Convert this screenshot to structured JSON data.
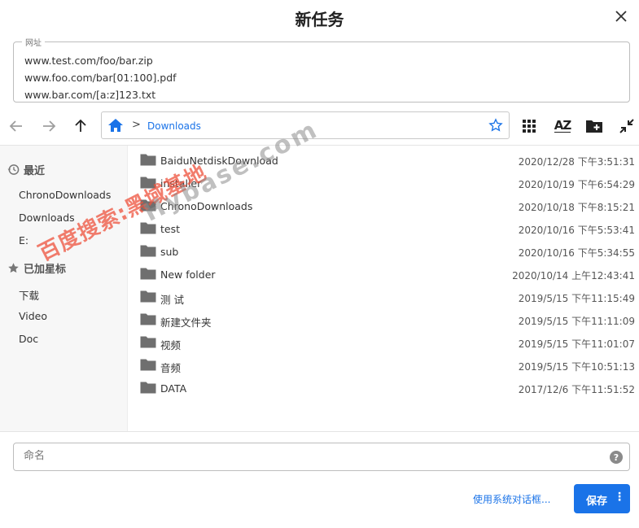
{
  "dialog": {
    "title": "新任务"
  },
  "url_field": {
    "legend": "网址",
    "lines": [
      "www.test.com/foo/bar.zip",
      "www.foo.com/bar[01:100].pdf",
      "www.bar.com/[a:z]123.txt"
    ]
  },
  "toolbar": {
    "icons": [
      "back-arrow-icon",
      "forward-arrow-icon",
      "up-arrow-icon",
      "home-icon",
      "chevron-right-icon",
      "star-outline-icon",
      "grid-view-icon",
      "sort-az-icon",
      "new-folder-icon",
      "collapse-icon"
    ],
    "breadcrumb_sep": ">",
    "breadcrumb": "Downloads",
    "sort_label": "AZ"
  },
  "sidebar": {
    "recent_label": "最近",
    "recent_items": [
      "ChronoDownloads",
      "Downloads",
      "E:"
    ],
    "starred_label": "已加星标",
    "starred_items": [
      "下载",
      "Video",
      "Doc"
    ]
  },
  "files": [
    {
      "name": "BaiduNetdiskDownload",
      "date": "2020/12/28 下午3:51:31"
    },
    {
      "name": "installer",
      "date": "2020/10/19 下午6:54:29"
    },
    {
      "name": "ChronoDownloads",
      "date": "2020/10/18 下午8:15:21"
    },
    {
      "name": "test",
      "date": "2020/10/16 下午5:53:41"
    },
    {
      "name": "sub",
      "date": "2020/10/16 下午5:34:55"
    },
    {
      "name": "New folder",
      "date": "2020/10/14 上午12:43:41"
    },
    {
      "name": "测 试",
      "date": "2019/5/15 下午11:15:49"
    },
    {
      "name": "新建文件夹",
      "date": "2019/5/15 下午11:11:09"
    },
    {
      "name": "视频",
      "date": "2019/5/15 下午11:01:07"
    },
    {
      "name": "音频",
      "date": "2019/5/15 下午10:51:13"
    },
    {
      "name": "DATA",
      "date": "2017/12/6 下午11:51:52"
    }
  ],
  "name_field": {
    "placeholder": "命名",
    "help": "?"
  },
  "footer": {
    "system_dialog_link": "使用系统对话框...",
    "save_label": "保存",
    "save_more": "⋮"
  },
  "watermark": {
    "text": "百度搜索:黑域基地",
    "text2": "Hybase.com"
  },
  "colors": {
    "accent": "#1a73e8",
    "folder": "#6f6f6f",
    "watermark": "#ee523c"
  }
}
